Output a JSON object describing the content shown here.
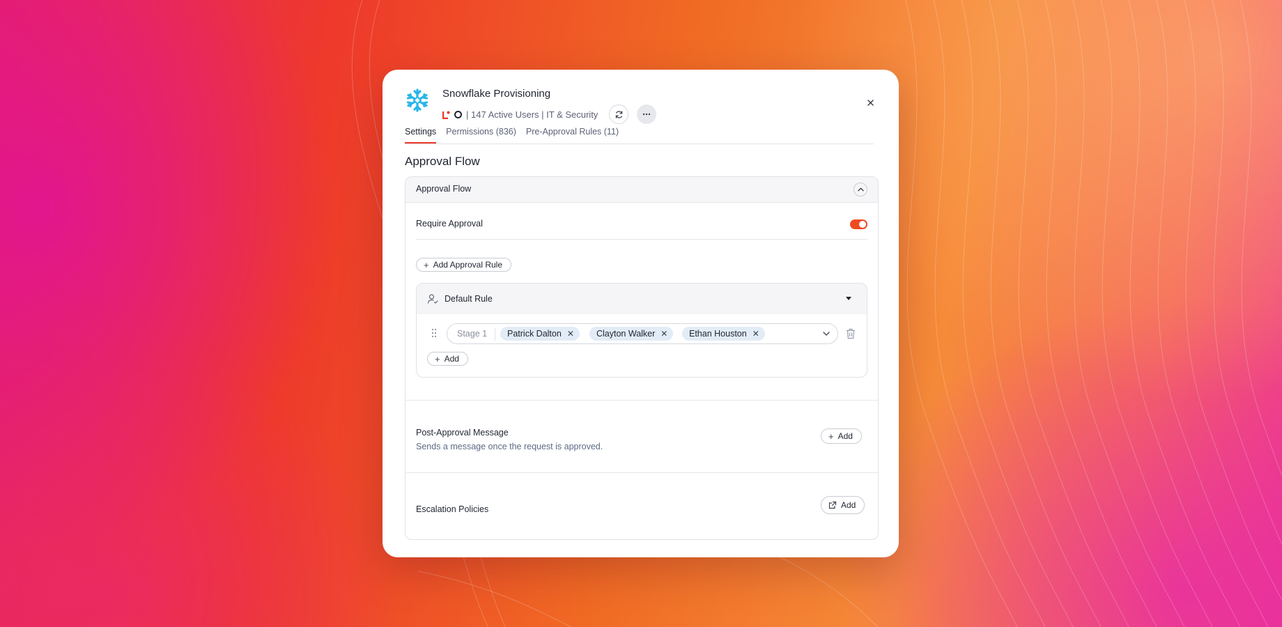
{
  "colors": {
    "accent": "#ee4b22",
    "chip_bg": "#e2ecf6",
    "snowflake": "#29b5e8"
  },
  "app": {
    "title": "Snowflake Provisioning",
    "meta": "| 147 Active Users | IT & Security",
    "logo_icon": "snowflake-logo",
    "sync_icon": "refresh-icon",
    "more_icon": "more-horizontal-icon",
    "close_icon": "close-icon"
  },
  "tabs": [
    {
      "label": "Settings",
      "active": true
    },
    {
      "label": "Permissions (836)",
      "active": false
    },
    {
      "label": "Pre-Approval Rules (11)",
      "active": false
    }
  ],
  "section_title": "Approval Flow",
  "panel": {
    "header_label": "Approval Flow",
    "require_approval": {
      "label": "Require Approval",
      "enabled": true
    },
    "add_rule_label": "Add Approval Rule",
    "default_rule": {
      "label": "Default Rule",
      "stage": {
        "label": "Stage 1",
        "approvers": [
          "Patrick Dalton",
          "Clayton Walker",
          "Ethan Houston"
        ]
      },
      "add_label": "Add"
    },
    "post_approval": {
      "title": "Post-Approval Message",
      "subtitle": "Sends a message once the request is approved.",
      "add_label": "Add"
    },
    "escalation": {
      "title": "Escalation Policies",
      "add_label": "Add"
    }
  }
}
